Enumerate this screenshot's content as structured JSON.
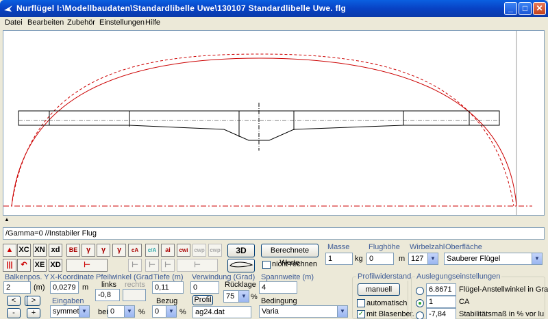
{
  "window": {
    "title": "Nurflügel   I:\\Modellbaudaten\\Standardlibelle Uwe\\130107 Standardlibelle Uwe. flg",
    "minimize": "_",
    "maximize": "□",
    "close": "✕"
  },
  "menu": [
    "Datei",
    "Bearbeiten",
    "Zubehör",
    "Einstellungen",
    "Hilfe"
  ],
  "canvas": {
    "marker": "▲"
  },
  "status": "/Gamma=0  //Instabiler Flug",
  "toolbar": {
    "row1": [
      "XC",
      "XN",
      "xd"
    ],
    "row1_icons": [
      "BE",
      "γ",
      "γ",
      "γ",
      "cA",
      "c/A",
      "ai",
      "cwi",
      "cwp",
      "cwp"
    ],
    "row2": [
      "XE",
      "XD"
    ],
    "btn_3d": "3D",
    "btn_berechnete": "Berechnete Werte",
    "nicht_rechnen": "nicht rechnen"
  },
  "masse": {
    "label": "Masse",
    "value": "1",
    "unit": "kg"
  },
  "flughoehe": {
    "label": "Flughöhe",
    "value": "0",
    "unit": "m"
  },
  "wirbelzahl": {
    "label": "Wirbelzahl",
    "value": "127"
  },
  "oberflaeche": {
    "label": "Oberfläche",
    "value": "Sauberer Flügel"
  },
  "balkenpos": {
    "label": "Balkenpos. Y",
    "value": "2",
    "unit": "(m)",
    "left": "<",
    "right": ">",
    "minus": "-",
    "plus": "+"
  },
  "xkoordinate": {
    "label": "X-Koordinate",
    "value": "0,0279",
    "unit": "m"
  },
  "eingaben": {
    "label": "Eingaben",
    "value": "symmetr"
  },
  "pfeilwinkel": {
    "label": "Pfeilwinkel (Grad",
    "links": "links",
    "rechts": "rechts",
    "value": "-0,8",
    "bei_label": "bei",
    "bei_value": "0",
    "unit": "%"
  },
  "tiefe": {
    "label": "Tiefe (m)",
    "value": "0,11",
    "bezug_label": "Bezug",
    "bezug_value": "0",
    "unit": "%"
  },
  "verwindung": {
    "label": "Verwindung (Grad)",
    "value": "0",
    "ruecklage_label": "Rücklage",
    "ruecklage_value": "75",
    "unit": "%",
    "profil_btn": "Profil",
    "profil_file": "ag24.dat"
  },
  "spannweite": {
    "label": "Spannweite (m)",
    "value": "4",
    "bedingung_label": "Bedingung",
    "bedingung_value": "Varia"
  },
  "profilwiderstand": {
    "label": "Profilwiderstand",
    "manuell": "manuell",
    "automatisch": "automatisch",
    "blasen": "mit Blasenber.",
    "blasen_checked": "✓"
  },
  "auslegung": {
    "label": "Auslegungseinstellungen",
    "rows": [
      {
        "value": "6.8671",
        "text": "Flügel-Anstellwinkel in Grad"
      },
      {
        "value": "1",
        "text": "CA"
      },
      {
        "value": "-7,84",
        "text": "Stabilitätsmaß in % vor lu"
      }
    ]
  }
}
